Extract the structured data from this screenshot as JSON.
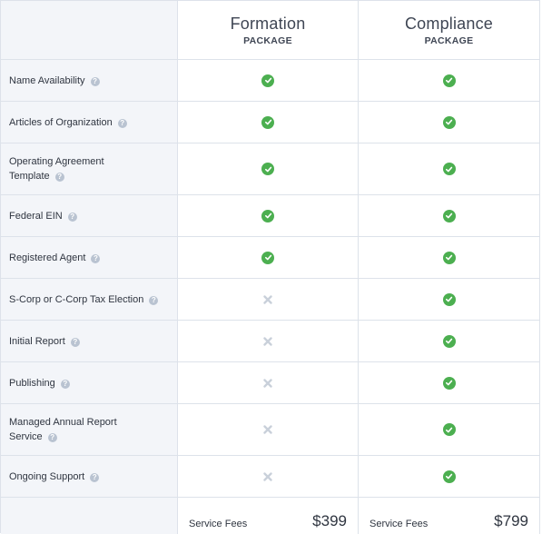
{
  "packages": [
    {
      "title": "Formation",
      "subtitle": "PACKAGE",
      "fee_label": "Service Fees",
      "fee_price": "$399"
    },
    {
      "title": "Compliance",
      "subtitle": "PACKAGE",
      "fee_label": "Service Fees",
      "fee_price": "$799"
    }
  ],
  "features": [
    {
      "label": "Name Availability",
      "formation": "included",
      "compliance": "included"
    },
    {
      "label": "Articles of Organization",
      "formation": "included",
      "compliance": "included"
    },
    {
      "label": "Operating Agreement Template",
      "formation": "included",
      "compliance": "included"
    },
    {
      "label": "Federal EIN",
      "formation": "included",
      "compliance": "included"
    },
    {
      "label": "Registered Agent",
      "formation": "included",
      "compliance": "included"
    },
    {
      "label": "S-Corp or C-Corp Tax Election",
      "formation": "not-included",
      "compliance": "included"
    },
    {
      "label": "Initial Report",
      "formation": "not-included",
      "compliance": "included"
    },
    {
      "label": "Publishing",
      "formation": "not-included",
      "compliance": "included"
    },
    {
      "label": "Managed Annual Report Service",
      "formation": "not-included",
      "compliance": "included"
    },
    {
      "label": "Ongoing Support",
      "formation": "not-included",
      "compliance": "included"
    }
  ],
  "icons": {
    "included": "check-circle-icon",
    "not_included": "x-mark-icon",
    "help": "question-circle-icon"
  },
  "colors": {
    "check": "#4caf50",
    "cross": "#c9d0da",
    "label_bg": "#f3f5f9",
    "border": "#dde2ea"
  }
}
